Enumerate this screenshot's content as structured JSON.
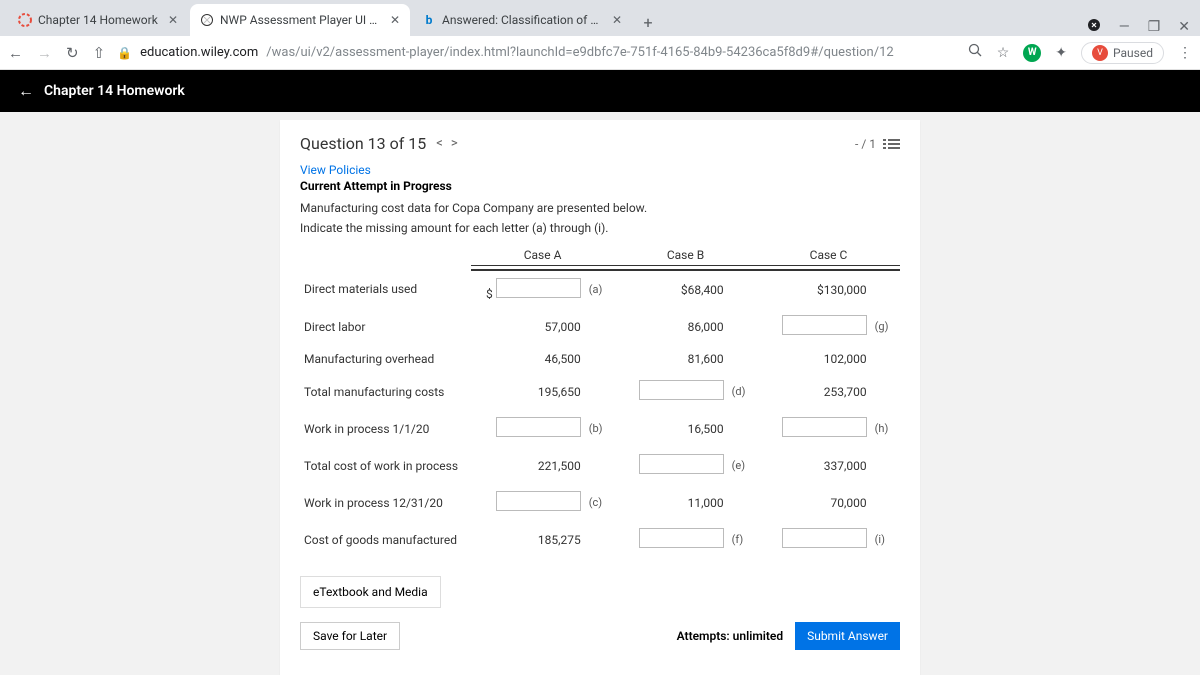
{
  "browser": {
    "tabs": [
      {
        "title": "Chapter 14 Homework",
        "active": false
      },
      {
        "title": "NWP Assessment Player UI Appli",
        "active": true
      },
      {
        "title": "Answered: Classification of Costs",
        "active": false
      }
    ],
    "url_host": "education.wiley.com",
    "url_path": "/was/ui/v2/assessment-player/index.html?launchId=e9dbfc7e-751f-4165-84b9-54236ca5f8d9#/question/12",
    "paused_label": "Paused"
  },
  "header": {
    "title": "Chapter 14 Homework"
  },
  "question": {
    "title": "Question 13 of 15",
    "page_indicator": "- / 1",
    "policies_link": "View Policies",
    "status": "Current Attempt in Progress",
    "intro1": "Manufacturing cost data for Copa Company are presented below.",
    "intro2": "Indicate the missing amount for each letter (a) through (i).",
    "cols": {
      "a": "Case A",
      "b": "Case B",
      "c": "Case C"
    },
    "rows": {
      "dmu": {
        "label": "Direct materials used",
        "a_input": true,
        "a_let": "(a)",
        "b_val": "$68,400",
        "c_val": "$130,000"
      },
      "dl": {
        "label": "Direct labor",
        "a_val": "57,000",
        "b_val": "86,000",
        "c_input": true,
        "c_let": "(g)"
      },
      "moh": {
        "label": "Manufacturing overhead",
        "a_val": "46,500",
        "b_val": "81,600",
        "c_val": "102,000"
      },
      "tmc": {
        "label": "Total manufacturing costs",
        "a_val": "195,650",
        "b_input": true,
        "b_let": "(d)",
        "c_val": "253,700"
      },
      "wip1": {
        "label": "Work in process 1/1/20",
        "a_input": true,
        "a_let": "(b)",
        "b_val": "16,500",
        "c_input": true,
        "c_let": "(h)"
      },
      "tcw": {
        "label": "Total cost of work in process",
        "a_val": "221,500",
        "b_input": true,
        "b_let": "(e)",
        "c_val": "337,000"
      },
      "wip2": {
        "label": "Work in process 12/31/20",
        "a_input": true,
        "a_let": "(c)",
        "b_val": "11,000",
        "c_val": "70,000"
      },
      "cogm": {
        "label": "Cost of goods manufactured",
        "a_val": "185,275",
        "b_input": true,
        "b_let": "(f)",
        "c_input": true,
        "c_let": "(i)"
      }
    },
    "etextbook_btn": "eTextbook and Media",
    "save_btn": "Save for Later",
    "attempts_label": "Attempts: unlimited",
    "submit_btn": "Submit Answer"
  }
}
